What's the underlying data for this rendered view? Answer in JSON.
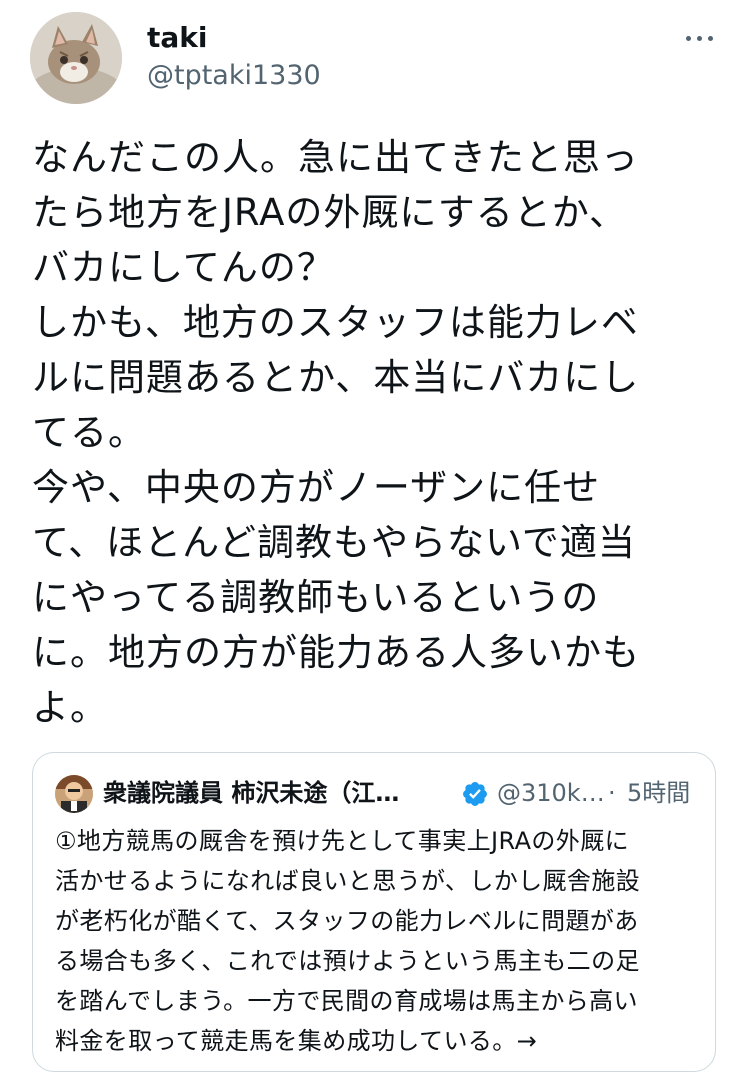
{
  "tweet": {
    "display_name": "taki",
    "handle": "@tptaki1330",
    "more_icon": "more-horizontal-icon",
    "body": "なんだこの人。急に出てきたと思っ\nたら地方をJRAの外厩にするとか、\nバカにしてんの？\nしかも、地方のスタッフは能力レベ\nルに問題あるとか、本当にバカにし\nてる。\n今や、中央の方がノーザンに任せ\nて、ほとんど調教もやらないで適当\nにやってる調教師もいるというの\nに。地方の方が能力ある人多いかも\nよ。"
  },
  "quote": {
    "display_name": "衆議院議員 柿沢未途（江…",
    "verified_icon": "verified-badge-icon",
    "handle": "@310k…",
    "separator": "·",
    "time": "5時間",
    "text": "①地方競馬の厩舎を預け先として事実上JRAの外厩に\n活かせるようになれば良いと思うが、しかし厩舎施設\nが老朽化が酷くて、スタッフの能力レベルに問題があ\nる場合も多く、これでは預けようという馬主も二の足\nを踏んでしまう。一方で民間の育成場は馬主から高い\n料金を取って競走馬を集め成功している。→"
  },
  "colors": {
    "text_primary": "#0f1419",
    "text_secondary": "#536471",
    "border": "#cfd9de",
    "verified_blue": "#1d9bf0"
  }
}
